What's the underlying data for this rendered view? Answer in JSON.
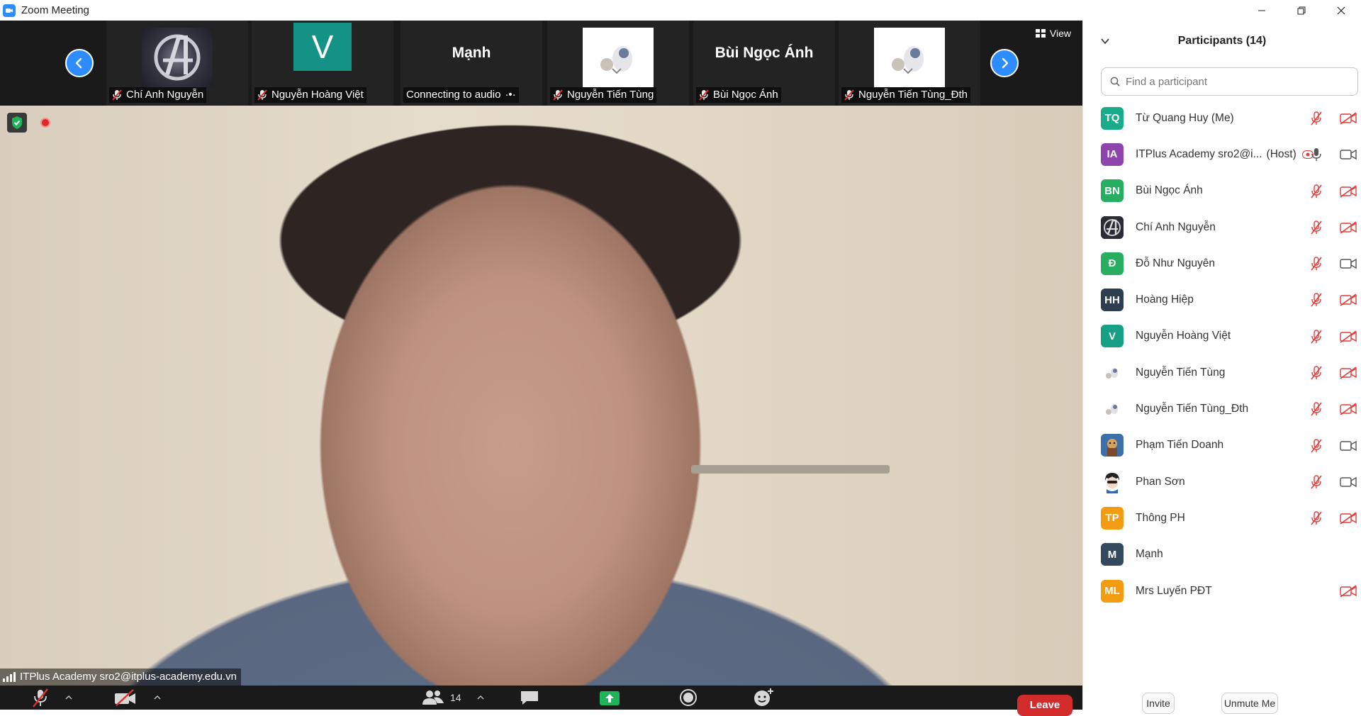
{
  "window": {
    "title": "Zoom Meeting",
    "controls": [
      "minimize",
      "restore",
      "close"
    ]
  },
  "filmstrip": {
    "view_label": "View",
    "tiles": [
      {
        "name": "Chí Anh Nguyễn",
        "type": "image",
        "muted": true
      },
      {
        "name": "Nguyễn Hoàng Việt",
        "type": "letter",
        "letter": "V",
        "color": "#159286",
        "muted": true
      },
      {
        "name": "Mạnh",
        "type": "name",
        "label": "Connecting to audio",
        "muted": false
      },
      {
        "name": "Nguyễn Tiến Tùng",
        "type": "image",
        "muted": true
      },
      {
        "name": "Bùi Ngọc Ánh",
        "type": "name",
        "label": "Bùi Ngọc Ánh",
        "muted": true
      },
      {
        "name": "Nguyễn Tiến Tùng_Đth",
        "type": "image",
        "muted": true
      }
    ]
  },
  "video": {
    "speaker_label": "ITPlus Academy sro2@itplus-academy.edu.vn",
    "recording": true
  },
  "toolbar": {
    "participants_count": "14",
    "leave_label": "Leave"
  },
  "panel": {
    "title": "Participants (14)",
    "search_placeholder": "Find a participant",
    "participants": [
      {
        "initials": "TQ",
        "color": "#1aab8a",
        "name": "Từ Quang Huy (Me)",
        "host": "",
        "mic": "off",
        "cam": "off"
      },
      {
        "initials": "IA",
        "color": "#8e44ad",
        "name": "ITPlus Academy sro2@i...",
        "host": "(Host)",
        "mic": "on",
        "cam": "on"
      },
      {
        "initials": "BN",
        "color": "#27ae60",
        "name": "Bùi Ngọc Ánh",
        "host": "",
        "mic": "off",
        "cam": "off"
      },
      {
        "initials": "",
        "color": "#3b3b4f",
        "name": "Chí Anh Nguyễn",
        "host": "",
        "mic": "off",
        "cam": "off",
        "image": "avengers"
      },
      {
        "initials": "Đ",
        "color": "#27ae60",
        "name": "Đỗ Như Nguyên",
        "host": "",
        "mic": "off",
        "cam": "on"
      },
      {
        "initials": "HH",
        "color": "#2c3e50",
        "name": "Hoàng Hiệp",
        "host": "",
        "mic": "off",
        "cam": "off"
      },
      {
        "initials": "V",
        "color": "#16a085",
        "name": "Nguyễn Hoàng Việt",
        "host": "",
        "mic": "off",
        "cam": "off"
      },
      {
        "initials": "",
        "color": "#ffffff",
        "name": "Nguyễn Tiến Tùng",
        "host": "",
        "mic": "off",
        "cam": "off",
        "image": "figure"
      },
      {
        "initials": "",
        "color": "#ffffff",
        "name": "Nguyễn Tiến Tùng_Đth",
        "host": "",
        "mic": "off",
        "cam": "off",
        "image": "figure"
      },
      {
        "initials": "",
        "color": "#3d6fa8",
        "name": "Phạm Tiến Doanh",
        "host": "",
        "mic": "off",
        "cam": "on",
        "image": "cartoon"
      },
      {
        "initials": "",
        "color": "#ffffff",
        "name": "Phan Sơn",
        "host": "",
        "mic": "off",
        "cam": "on",
        "image": "anime"
      },
      {
        "initials": "TP",
        "color": "#f39c12",
        "name": "Thông PH",
        "host": "",
        "mic": "off",
        "cam": "off"
      },
      {
        "initials": "M",
        "color": "#34495e",
        "name": "Mạnh",
        "host": "",
        "mic": "none",
        "cam": "none"
      },
      {
        "initials": "ML",
        "color": "#f39c12",
        "name": "Mrs Luyến PĐT",
        "host": "",
        "mic": "none",
        "cam": "off"
      }
    ],
    "invite_label": "Invite",
    "unmute_label": "Unmute Me"
  }
}
